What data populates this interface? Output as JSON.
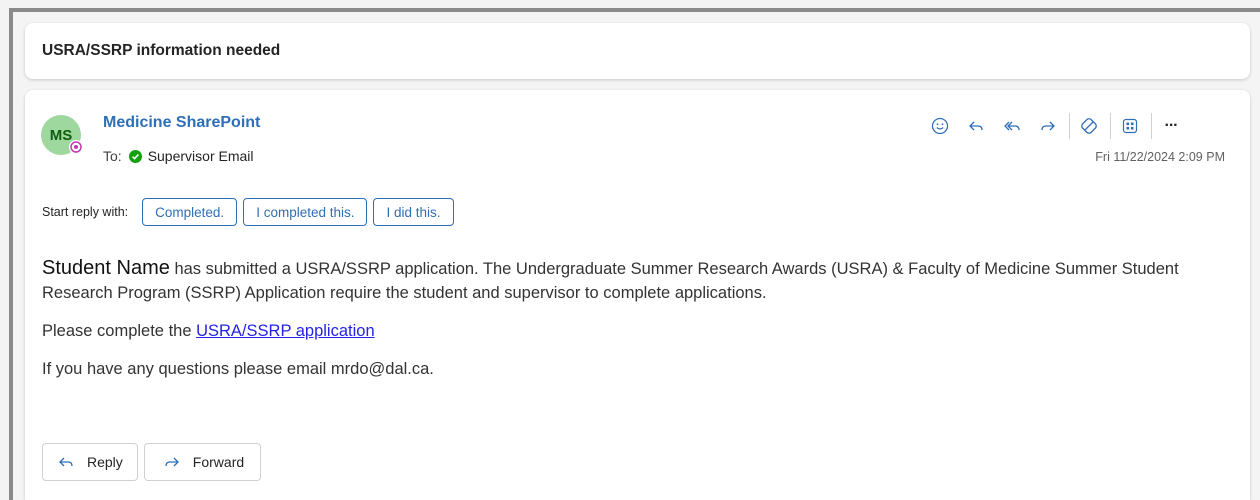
{
  "subject": "USRA/SSRP information needed",
  "message": {
    "avatar_initials": "MS",
    "sender": "Medicine SharePoint",
    "to_label": "To:",
    "recipient": "Supervisor Email",
    "timestamp": "Fri 11/22/2024 2:09 PM"
  },
  "toolbar": {
    "icons": [
      "emoji-icon",
      "reply-icon",
      "reply-all-icon",
      "forward-icon",
      "loop-icon",
      "apps-icon",
      "more-icon"
    ],
    "more_label": "···"
  },
  "quick_reply": {
    "label": "Start reply with:",
    "options": [
      "Completed.",
      "I completed this.",
      "I did this."
    ]
  },
  "body": {
    "student_name": "Student Name",
    "para1_rest": " has submitted a USRA/SSRP application. The Undergraduate Summer Research Awards (USRA) & Faculty of Medicine Summer Student Research Program (SSRP) Application require the student and supervisor to complete applications.",
    "para2_prefix": "Please complete the ",
    "para2_link": "USRA/SSRP application",
    "para3": "If you have any questions please email mrdo@dal.ca."
  },
  "actions": {
    "reply_label": "Reply",
    "forward_label": "Forward"
  },
  "colors": {
    "accent": "#2f6fb7",
    "avatar_bg": "#9fd89f",
    "presence": "#c239b3",
    "status_green": "#13a10e"
  }
}
